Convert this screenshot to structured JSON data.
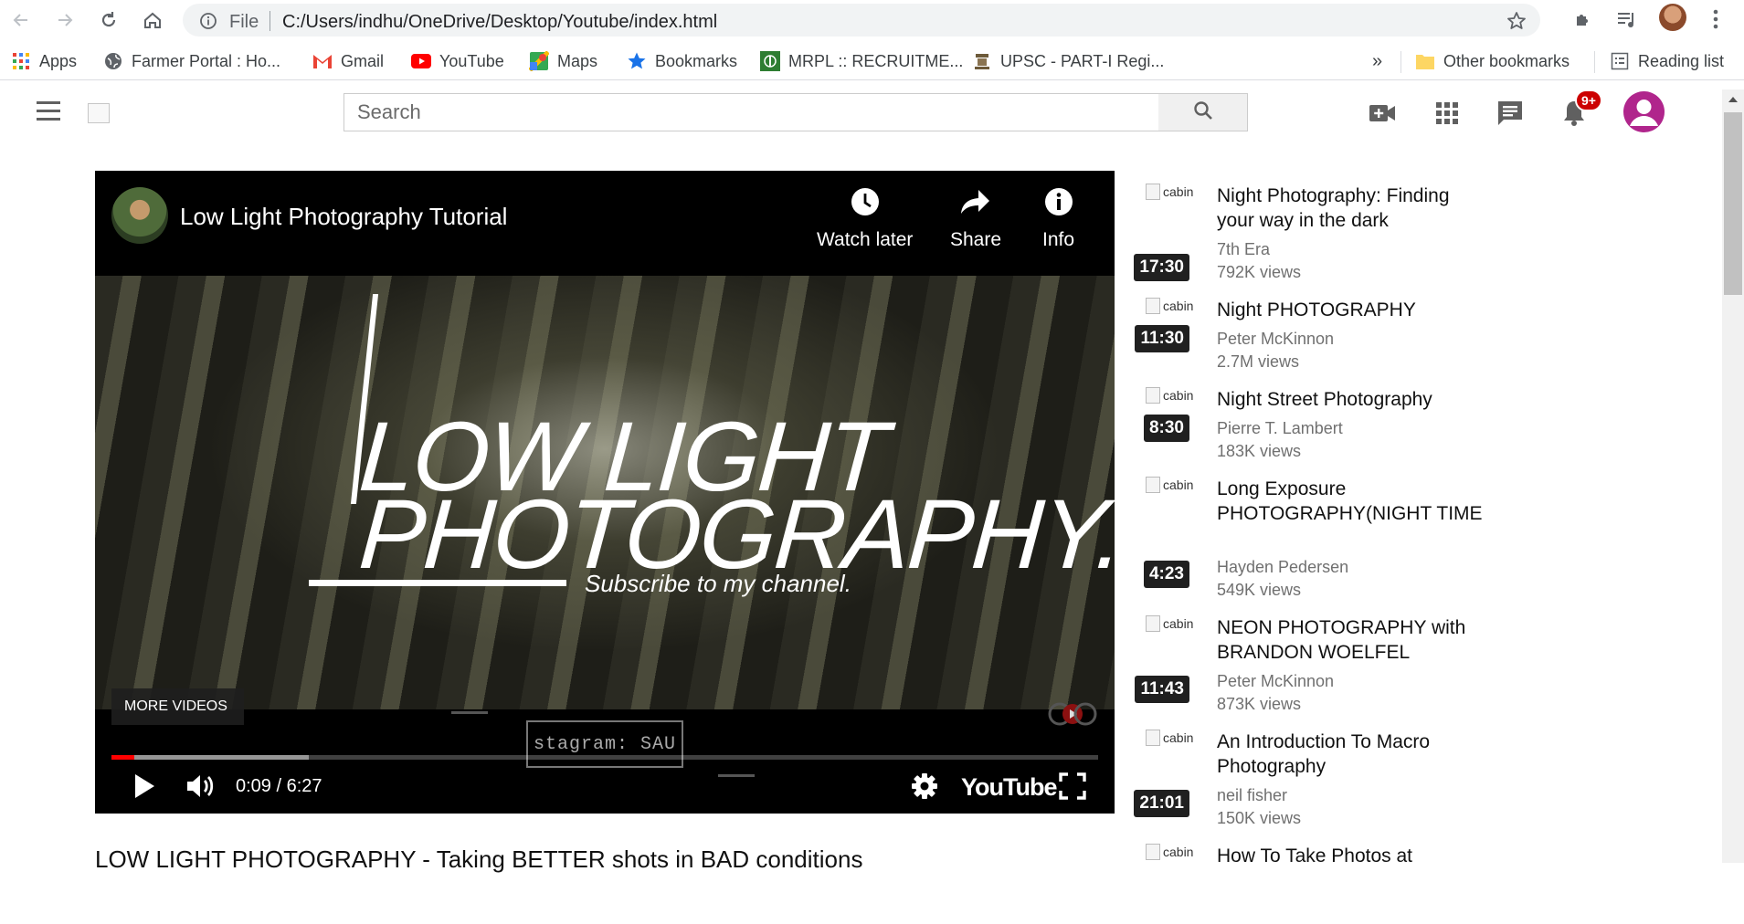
{
  "browser": {
    "url_scheme": "File",
    "url": "C:/Users/indhu/OneDrive/Desktop/Youtube/index.html",
    "bookmarks": [
      {
        "label": "Apps",
        "icon": "apps-grid-icon"
      },
      {
        "label": "Farmer Portal : Ho...",
        "icon": "globe-icon"
      },
      {
        "label": "Gmail",
        "icon": "gmail-icon"
      },
      {
        "label": "YouTube",
        "icon": "youtube-icon"
      },
      {
        "label": "Maps",
        "icon": "maps-icon"
      },
      {
        "label": "Bookmarks",
        "icon": "star-icon"
      },
      {
        "label": "MRPL :: RECRUITME...",
        "icon": "mrpl-icon"
      },
      {
        "label": "UPSC - PART-I Regi...",
        "icon": "emblem-icon"
      }
    ],
    "overflow": "»",
    "other_bookmarks": "Other bookmarks",
    "reading_list": "Reading list"
  },
  "youtube": {
    "search_placeholder": "Search",
    "notifications_badge": "9+",
    "player": {
      "title": "Low Light Photography Tutorial",
      "watch_later": "Watch later",
      "share": "Share",
      "info": "Info",
      "frame_line1": "LOW LIGHT",
      "frame_line2": "PHOTOGRAPHY.",
      "frame_subscribe": "Subscribe to my channel.",
      "more_videos": "MORE VIDEOS",
      "instagram_text": "stagram: SAU",
      "time": "0:09 / 6:27",
      "progress_played": 0.023,
      "progress_buffered": 0.2,
      "brand": "YouTube"
    },
    "below_title": "LOW LIGHT PHOTOGRAPHY - Taking BETTER shots in BAD conditions",
    "recommendations": [
      {
        "thumb_alt": "cabin",
        "duration": "17:30",
        "title": "Night Photography: Finding your way in the dark",
        "channel": "7th Era",
        "views": "792K views"
      },
      {
        "thumb_alt": "cabin",
        "duration": "11:30",
        "title": "Night PHOTOGRAPHY",
        "channel": "Peter McKinnon",
        "views": "2.7M views"
      },
      {
        "thumb_alt": "cabin",
        "duration": "8:30",
        "title": "Night Street Photography",
        "channel": "Pierre T. Lambert",
        "views": "183K views"
      },
      {
        "thumb_alt": "cabin",
        "duration": "4:23",
        "title": "Long Exposure PHOTOGRAPHY(NIGHT TIME",
        "channel": "Hayden Pedersen",
        "views": "549K views"
      },
      {
        "thumb_alt": "cabin",
        "duration": "11:43",
        "title": "NEON PHOTOGRAPHY with BRANDON WOELFEL",
        "channel": "Peter McKinnon",
        "views": "873K views"
      },
      {
        "thumb_alt": "cabin",
        "duration": "21:01",
        "title": "An Introduction To Macro Photography",
        "channel": "neil fisher",
        "views": "150K views"
      },
      {
        "thumb_alt": "cabin",
        "duration": "",
        "title": "How To Take Photos at",
        "channel": "",
        "views": ""
      }
    ]
  },
  "colors": {
    "accent_red": "#ff0000",
    "avatar": "#b0258c",
    "badge": "#cc0000"
  }
}
